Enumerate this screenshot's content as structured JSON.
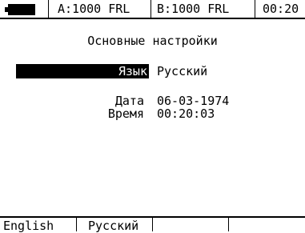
{
  "status_bar": {
    "port_a": "A:1000 FRL",
    "port_b": "B:1000 FRL",
    "time": "00:20",
    "battery_icon": "battery-icon"
  },
  "settings": {
    "title": "Основные настройки",
    "language_label": "Язык",
    "language_value": "Русский",
    "date_label": "Дата",
    "date_value": "06-03-1974",
    "time_label": "Время",
    "time_value": "00:20:03"
  },
  "softkeys": {
    "english": "English",
    "russian": "Русский"
  },
  "colors": {
    "foreground": "#000000",
    "background": "#ffffff",
    "highlight_text": "#ffffff"
  }
}
